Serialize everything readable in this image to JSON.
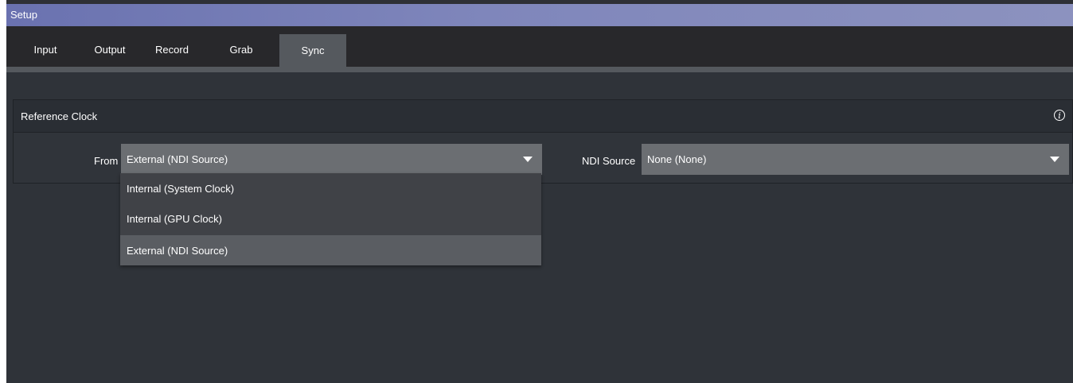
{
  "window": {
    "title": "Setup"
  },
  "tabs": [
    {
      "label": "Input",
      "active": false
    },
    {
      "label": "Output",
      "active": false
    },
    {
      "label": "Record",
      "active": false
    },
    {
      "label": "Grab",
      "active": false
    },
    {
      "label": "Sync",
      "active": true
    }
  ],
  "reference_clock": {
    "title": "Reference Clock",
    "info_icon": "info-icon",
    "from": {
      "label": "From",
      "value": "External (NDI Source)",
      "options": [
        "Internal (System Clock)",
        "Internal (GPU Clock)",
        "External (NDI Source)"
      ],
      "selected_index": 2
    },
    "ndi_source": {
      "label": "NDI Source",
      "value": "None (None)"
    }
  },
  "colors": {
    "titlebar": "#7a80b8",
    "active_tab": "#55595e",
    "select_bg": "#6b6e72",
    "dropdown_bg": "#404247"
  }
}
